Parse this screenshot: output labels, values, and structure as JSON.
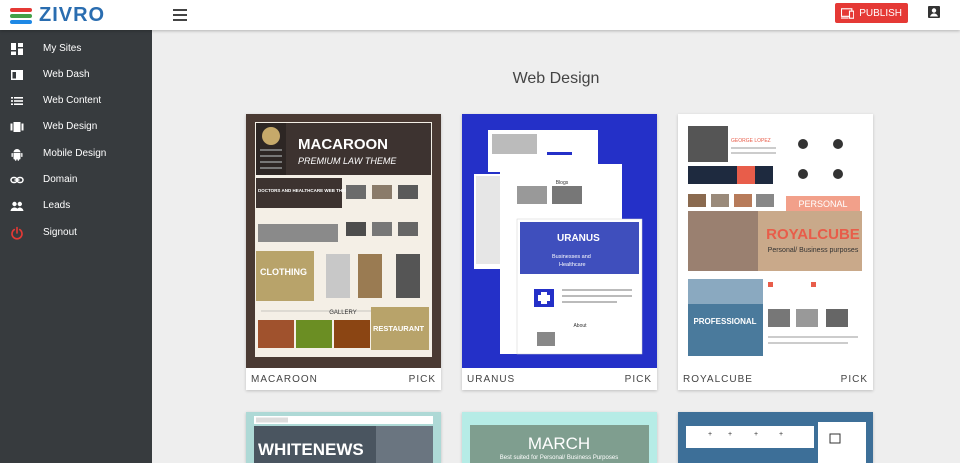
{
  "brand": {
    "name": "ZIVRO"
  },
  "topbar": {
    "publish_label": "PUBLISH"
  },
  "sidebar": {
    "items": [
      {
        "label": "My Sites",
        "icon": "dashboard-grid-icon"
      },
      {
        "label": "Web Dash",
        "icon": "web-dash-icon"
      },
      {
        "label": "Web Content",
        "icon": "list-icon"
      },
      {
        "label": "Web Design",
        "icon": "web-design-icon"
      },
      {
        "label": "Mobile Design",
        "icon": "android-icon"
      },
      {
        "label": "Domain",
        "icon": "link-icon"
      },
      {
        "label": "Leads",
        "icon": "people-icon"
      },
      {
        "label": "Signout",
        "icon": "power-icon"
      }
    ]
  },
  "main": {
    "title": "Web Design"
  },
  "templates": [
    {
      "name": "MACAROON",
      "pick": "PICK",
      "preview": {
        "title": "MACAROON",
        "subtitle": "PREMIUM LAW THEME",
        "section1": "DOCTORS AND HEALTHCARE WEB THEMES",
        "section2": "CLOTHING",
        "section3": "GALLERY",
        "section4": "RESTAURANT"
      }
    },
    {
      "name": "URANUS",
      "pick": "PICK",
      "preview": {
        "title": "URANUS",
        "line1": "Businesses and",
        "line2": "Healthcare",
        "blog": "Blogs",
        "about": "About"
      }
    },
    {
      "name": "ROYALCUBE",
      "pick": "PICK",
      "preview": {
        "person": "GEORGE LOPEZ",
        "tag": "PERSONAL",
        "title": "ROYALCUBE",
        "subtitle": "Personal/ Business purposes",
        "banner": "PROFESSIONAL"
      }
    }
  ],
  "templates_row2": [
    {
      "preview_title": "WHITENEWS"
    },
    {
      "preview_title": "MARCH",
      "preview_subtitle": "Best suited for Personal/ Business Purposes"
    },
    {
      "preview_title": ""
    }
  ],
  "colors": {
    "accent": "#e53935",
    "sidebar": "#373b3e",
    "background": "#eeeeee",
    "uranus_blue": "#2430c8"
  }
}
